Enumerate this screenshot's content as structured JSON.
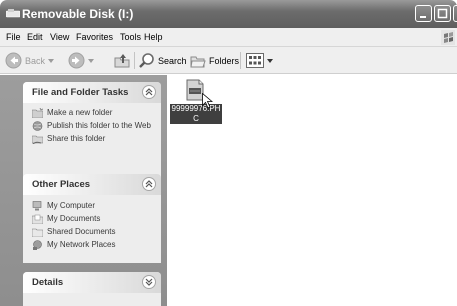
{
  "window": {
    "title": "Removable Disk (I:)"
  },
  "menu": {
    "items": [
      "File",
      "Edit",
      "View",
      "Favorites",
      "Tools",
      "Help"
    ]
  },
  "toolbar": {
    "back": "Back",
    "search": "Search",
    "folders": "Folders"
  },
  "tasks": {
    "title": "File and Folder Tasks",
    "items": [
      "Make a new folder",
      "Publish this folder to the Web",
      "Share this folder"
    ]
  },
  "places": {
    "title": "Other Places",
    "items": [
      "My Computer",
      "My Documents",
      "Shared Documents",
      "My Network Places"
    ]
  },
  "details": {
    "title": "Details"
  },
  "files": [
    {
      "name": "99999976.PHC",
      "selected": true
    }
  ],
  "colors": {
    "title_bar": "#6c6c6c",
    "panel": "#ededed",
    "selection": "#3f3f3f"
  }
}
